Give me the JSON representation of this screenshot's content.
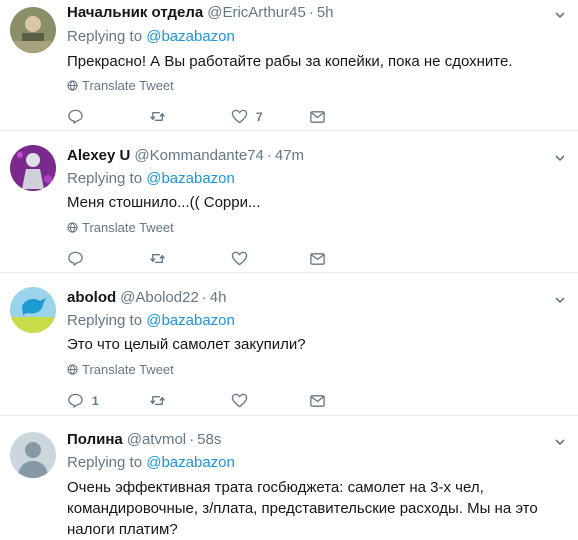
{
  "translate_label": "Translate Tweet",
  "replying_label": "Replying to",
  "tweets": [
    {
      "name": "Начальник отдела",
      "handle": "@EricArthur45",
      "time": "5h",
      "mention": "@bazabazon",
      "text": "Прекрасно! А Вы работайте рабы за копейки, пока не сдохните.",
      "likes": "7",
      "replies": ""
    },
    {
      "name": "Alexey U",
      "handle": "@Kommandante74",
      "time": "47m",
      "mention": "@bazabazon",
      "text": "Меня стошнило...(( Сорри...",
      "likes": "",
      "replies": ""
    },
    {
      "name": "abolod",
      "handle": "@Abolod22",
      "time": "4h",
      "mention": "@bazabazon",
      "text": "Это что целый самолет закупили?",
      "likes": "",
      "replies": "1"
    },
    {
      "name": "Полина",
      "handle": "@atvmol",
      "time": "58s",
      "mention": "@bazabazon",
      "text": "Очень эффективная трата госбюджета: самолет на 3-х чел, командировочные, з/плата, представительские расходы. Мы на это налоги платим?",
      "likes": "",
      "replies": ""
    }
  ],
  "icons": {
    "reply": "reply-icon",
    "retweet": "retweet-icon",
    "like": "heart-icon",
    "dm": "envelope-icon",
    "translate": "globe-icon",
    "more": "chevron-down-icon"
  },
  "colors": {
    "link": "#1b95e0",
    "muted": "#657786",
    "text": "#14171a",
    "border": "#e6ecf0"
  }
}
